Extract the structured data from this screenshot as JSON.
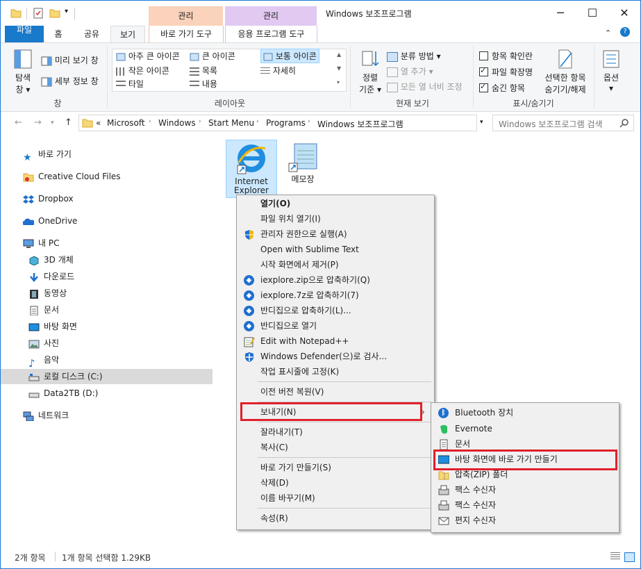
{
  "window": {
    "title": "Windows 보조프로그램",
    "ctx_group1": "관리",
    "ctx_group2": "관리",
    "minimize": "─",
    "maximize": "☐",
    "close": "✕"
  },
  "tabs": {
    "file": "파일",
    "home": "홈",
    "share": "공유",
    "view": "보기",
    "shortcut_tools": "바로 가기 도구",
    "app_tools": "응용 프로그램 도구"
  },
  "ribbon": {
    "pane": {
      "nav_pane_line1": "탐색",
      "nav_pane_line2": "창",
      "preview": "미리 보기 창",
      "details": "세부 정보 창",
      "label": "창"
    },
    "layout": {
      "extra_large": "아주 큰 아이콘",
      "large": "큰 아이콘",
      "medium": "보통 아이콘",
      "small": "작은 아이콘",
      "list": "목록",
      "details": "자세히",
      "tiles": "타일",
      "content": "내용",
      "label": "레이아웃"
    },
    "current_view": {
      "sort_line1": "정렬",
      "sort_line2": "기준",
      "group_by": "분류 방법",
      "add_columns": "열 추가",
      "size_columns": "모든 열 너비 조정",
      "label": "현재 보기"
    },
    "show_hide": {
      "item_checkboxes": "항목 확인란",
      "item_checkboxes_checked": false,
      "file_extensions": "파일 확장명",
      "file_extensions_checked": true,
      "hidden_items": "숨긴 항목",
      "hidden_items_checked": true,
      "hide_selected_line1": "선택한 항목",
      "hide_selected_line2": "숨기기/해제",
      "label": "표시/숨기기"
    },
    "options": "옵션"
  },
  "address": {
    "crumbs": [
      "«",
      "Microsoft",
      "Windows",
      "Start Menu",
      "Programs",
      "Windows 보조프로그램"
    ],
    "search_placeholder": "Windows 보조프로그램 검색"
  },
  "nav": {
    "quick_access": "바로 가기",
    "creative_cloud": "Creative Cloud Files",
    "dropbox": "Dropbox",
    "onedrive": "OneDrive",
    "this_pc": "내 PC",
    "objects3d": "3D 개체",
    "downloads": "다운로드",
    "videos": "동영상",
    "documents": "문서",
    "desktop": "바탕 화면",
    "pictures": "사진",
    "music": "음악",
    "local_disk": "로컬 디스크 (C:)",
    "data_disk": "Data2TB (D:)",
    "network": "네트워크"
  },
  "files": [
    {
      "line1": "Internet",
      "line2": "Explorer",
      "icon": "internet-explorer-icon"
    },
    {
      "line1": "메모장",
      "line2": "",
      "icon": "notepad-icon"
    }
  ],
  "context_menu": [
    {
      "label": "열기(O)",
      "bold": true,
      "icon": ""
    },
    {
      "label": "파일 위치 열기(I)",
      "icon": ""
    },
    {
      "label": "관리자 권한으로 실행(A)",
      "icon": "shield-icon"
    },
    {
      "label": "Open with Sublime Text",
      "icon": ""
    },
    {
      "label": "시작 화면에서 제거(P)",
      "icon": ""
    },
    {
      "label": "iexplore.zip으로 압축하기(Q)",
      "icon": "bandizip-icon"
    },
    {
      "label": "iexplore.7z로 압축하기(7)",
      "icon": "bandizip-icon"
    },
    {
      "label": "반디집으로 압축하기(L)...",
      "icon": "bandizip-icon"
    },
    {
      "label": "반디집으로 열기",
      "icon": "bandizip-icon"
    },
    {
      "label": "Edit with Notepad++",
      "icon": "notepadpp-icon"
    },
    {
      "label": "Windows Defender(으)로 검사...",
      "icon": "defender-icon"
    },
    {
      "label": "작업 표시줄에 고정(K)",
      "icon": ""
    },
    {
      "label": "이전 버전 복원(V)",
      "icon": ""
    },
    {
      "label": "보내기(N)",
      "icon": ""
    },
    {
      "label": "잘라내기(T)",
      "icon": ""
    },
    {
      "label": "복사(C)",
      "icon": ""
    },
    {
      "label": "바로 가기 만들기(S)",
      "icon": ""
    },
    {
      "label": "삭제(D)",
      "icon": ""
    },
    {
      "label": "이름 바꾸기(M)",
      "icon": ""
    },
    {
      "label": "속성(R)",
      "icon": ""
    }
  ],
  "send_to_menu": [
    {
      "label": "Bluetooth 장치",
      "icon": "bluetooth-icon"
    },
    {
      "label": "Evernote",
      "icon": "evernote-icon"
    },
    {
      "label": "문서",
      "icon": "document-icon"
    },
    {
      "label": "바탕 화면에 바로 가기 만들기",
      "icon": "desktop-icon"
    },
    {
      "label": "압축(ZIP) 폴더",
      "icon": "zip-folder-icon"
    },
    {
      "label": "팩스 수신자",
      "icon": "fax-icon"
    },
    {
      "label": "팩스 수신자",
      "icon": "fax-icon"
    },
    {
      "label": "편지 수신자",
      "icon": "mail-icon"
    }
  ],
  "status": {
    "count": "2개 항목",
    "selected": "1개 항목 선택함 1.29KB"
  },
  "colors": {
    "accent": "#1979ca",
    "highlight_box": "#e0202a",
    "ctx_tab1": "#fbd2bb",
    "ctx_tab2": "#e1c9f2",
    "selection": "#cce8ff"
  }
}
